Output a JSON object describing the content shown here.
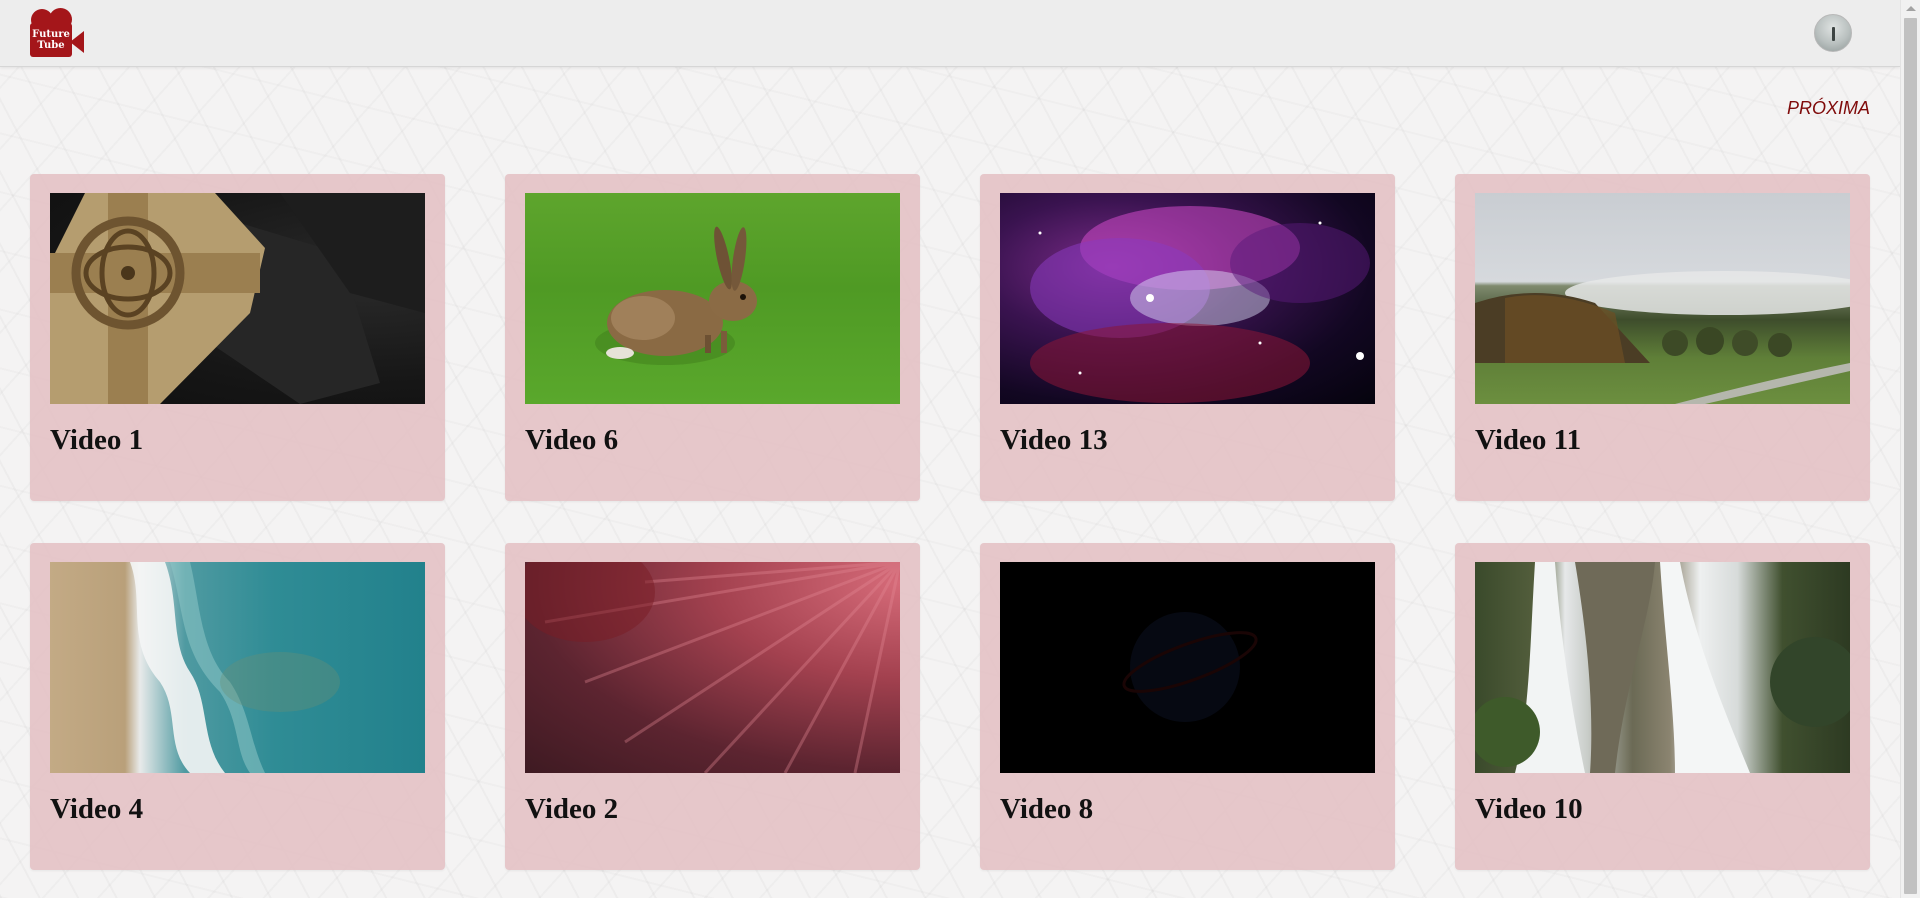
{
  "header": {
    "logo": {
      "icon": "movie-camera-icon",
      "brand_color": "#a4161a",
      "line1": "Future",
      "line2": "Tube"
    },
    "avatar_icon": "user-avatar-icon"
  },
  "pagination": {
    "next_label": "PRÓXIMA",
    "color": "#7f0a0a"
  },
  "videos": [
    {
      "title": "Video 1",
      "thumbnail": "celtic-cross-thumbnail"
    },
    {
      "title": "Video 6",
      "thumbnail": "hare-on-grass-thumbnail"
    },
    {
      "title": "Video 13",
      "thumbnail": "purple-nebula-thumbnail"
    },
    {
      "title": "Video 11",
      "thumbnail": "misty-field-thumbnail"
    },
    {
      "title": "Video 4",
      "thumbnail": "beach-aerial-thumbnail"
    },
    {
      "title": "Video 2",
      "thumbnail": "red-abstract-thumbnail"
    },
    {
      "title": "Video 8",
      "thumbnail": "dark-nasa-logo-thumbnail"
    },
    {
      "title": "Video 10",
      "thumbnail": "waterfall-thumbnail"
    }
  ],
  "theme": {
    "card_background": "#e4c3c6",
    "page_background": "#f4f3f3",
    "header_background": "#ededed"
  }
}
